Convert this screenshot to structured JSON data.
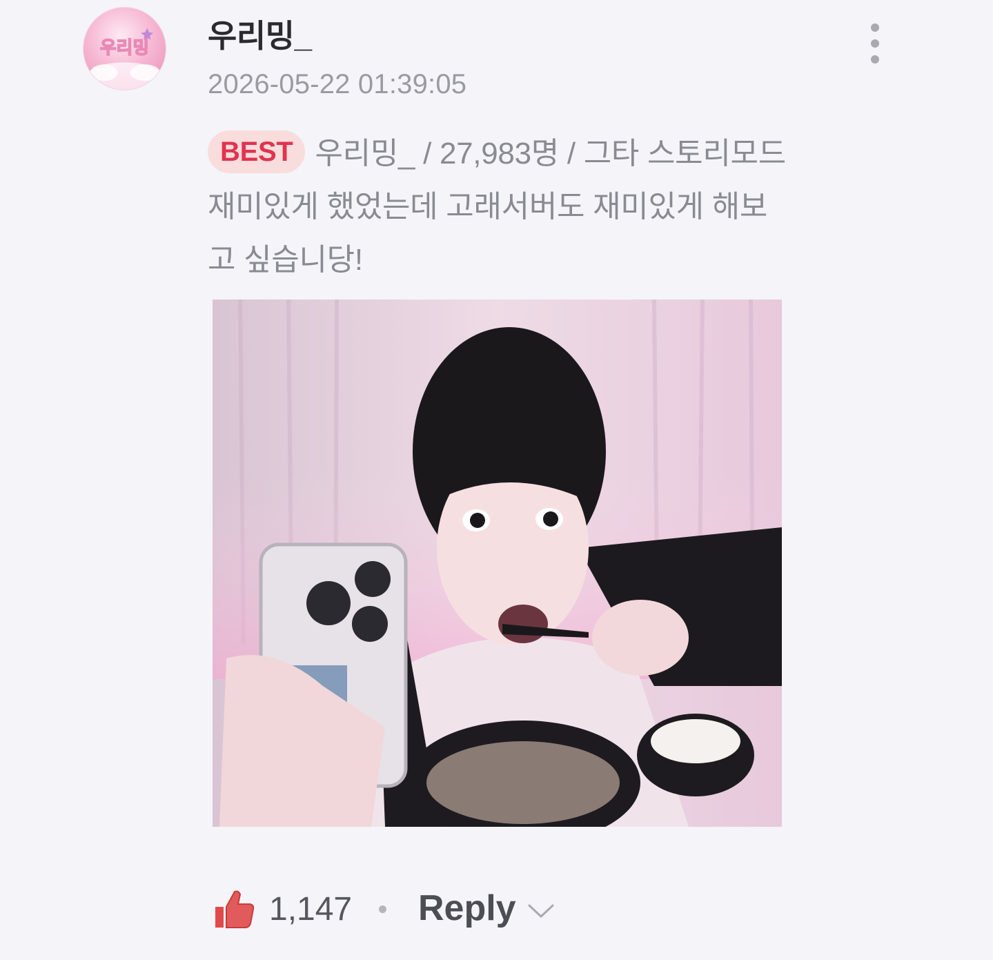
{
  "comment": {
    "avatar_text": "우리밍",
    "username": "우리밍_",
    "timestamp": "2026-05-22 01:39:05",
    "badge": "BEST",
    "text": "우리밍_ / 27,983명 / 그타 스토리모드 재미있게 했었는데 고래서버도 재미있게 해보고 싶습니당!",
    "likes": "1,147",
    "reply_label": "Reply"
  },
  "icons": {
    "more": "more-vertical-icon",
    "like": "thumbs-up-icon",
    "chevron": "chevron-down-icon"
  },
  "colors": {
    "background": "#f4f4f9",
    "badge_bg": "#f9dddd",
    "badge_text": "#e0344f",
    "like_icon": "#e04a4a"
  }
}
